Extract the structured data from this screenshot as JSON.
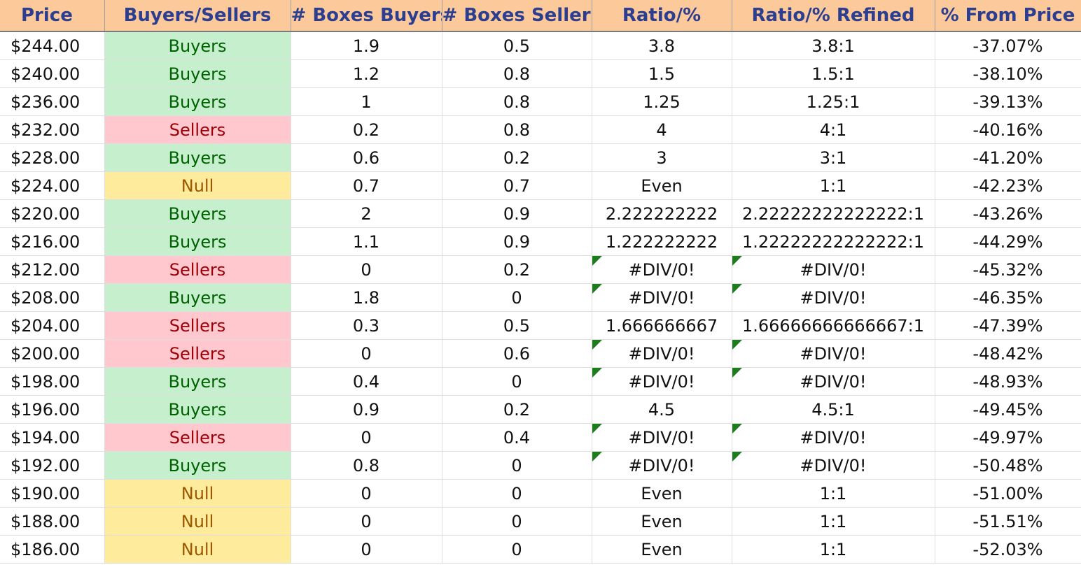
{
  "colors": {
    "header_bg": "#fcc99b",
    "header_text": "#2c3e8f",
    "buyers_bg": "#c6efce",
    "buyers_text": "#006100",
    "sellers_bg": "#ffc7ce",
    "sellers_text": "#9c0006",
    "null_bg": "#ffeb9c",
    "null_text": "#9c5700",
    "error_flag": "#1e7b1e"
  },
  "table": {
    "headers": [
      "Price",
      "Buyers/Sellers",
      "# Boxes Buyers",
      "# Boxes Sellers",
      "Ratio/%",
      "Ratio/% Refined",
      "% From Price"
    ],
    "rows": [
      {
        "price": "$244.00",
        "side": "Buyers",
        "boxes_buyers": "1.9",
        "boxes_sellers": "0.5",
        "ratio": "3.8",
        "ratio_refined": "3.8:1",
        "pct_from_price": "-37.07%",
        "error_flag": false
      },
      {
        "price": "$240.00",
        "side": "Buyers",
        "boxes_buyers": "1.2",
        "boxes_sellers": "0.8",
        "ratio": "1.5",
        "ratio_refined": "1.5:1",
        "pct_from_price": "-38.10%",
        "error_flag": false
      },
      {
        "price": "$236.00",
        "side": "Buyers",
        "boxes_buyers": "1",
        "boxes_sellers": "0.8",
        "ratio": "1.25",
        "ratio_refined": "1.25:1",
        "pct_from_price": "-39.13%",
        "error_flag": false
      },
      {
        "price": "$232.00",
        "side": "Sellers",
        "boxes_buyers": "0.2",
        "boxes_sellers": "0.8",
        "ratio": "4",
        "ratio_refined": "4:1",
        "pct_from_price": "-40.16%",
        "error_flag": false
      },
      {
        "price": "$228.00",
        "side": "Buyers",
        "boxes_buyers": "0.6",
        "boxes_sellers": "0.2",
        "ratio": "3",
        "ratio_refined": "3:1",
        "pct_from_price": "-41.20%",
        "error_flag": false
      },
      {
        "price": "$224.00",
        "side": "Null",
        "boxes_buyers": "0.7",
        "boxes_sellers": "0.7",
        "ratio": "Even",
        "ratio_refined": "1:1",
        "pct_from_price": "-42.23%",
        "error_flag": false
      },
      {
        "price": "$220.00",
        "side": "Buyers",
        "boxes_buyers": "2",
        "boxes_sellers": "0.9",
        "ratio": "2.222222222",
        "ratio_refined": "2.22222222222222:1",
        "pct_from_price": "-43.26%",
        "error_flag": false
      },
      {
        "price": "$216.00",
        "side": "Buyers",
        "boxes_buyers": "1.1",
        "boxes_sellers": "0.9",
        "ratio": "1.222222222",
        "ratio_refined": "1.22222222222222:1",
        "pct_from_price": "-44.29%",
        "error_flag": false
      },
      {
        "price": "$212.00",
        "side": "Sellers",
        "boxes_buyers": "0",
        "boxes_sellers": "0.2",
        "ratio": "#DIV/0!",
        "ratio_refined": "#DIV/0!",
        "pct_from_price": "-45.32%",
        "error_flag": true
      },
      {
        "price": "$208.00",
        "side": "Buyers",
        "boxes_buyers": "1.8",
        "boxes_sellers": "0",
        "ratio": "#DIV/0!",
        "ratio_refined": "#DIV/0!",
        "pct_from_price": "-46.35%",
        "error_flag": true
      },
      {
        "price": "$204.00",
        "side": "Sellers",
        "boxes_buyers": "0.3",
        "boxes_sellers": "0.5",
        "ratio": "1.666666667",
        "ratio_refined": "1.66666666666667:1",
        "pct_from_price": "-47.39%",
        "error_flag": false
      },
      {
        "price": "$200.00",
        "side": "Sellers",
        "boxes_buyers": "0",
        "boxes_sellers": "0.6",
        "ratio": "#DIV/0!",
        "ratio_refined": "#DIV/0!",
        "pct_from_price": "-48.42%",
        "error_flag": true
      },
      {
        "price": "$198.00",
        "side": "Buyers",
        "boxes_buyers": "0.4",
        "boxes_sellers": "0",
        "ratio": "#DIV/0!",
        "ratio_refined": "#DIV/0!",
        "pct_from_price": "-48.93%",
        "error_flag": true
      },
      {
        "price": "$196.00",
        "side": "Buyers",
        "boxes_buyers": "0.9",
        "boxes_sellers": "0.2",
        "ratio": "4.5",
        "ratio_refined": "4.5:1",
        "pct_from_price": "-49.45%",
        "error_flag": false
      },
      {
        "price": "$194.00",
        "side": "Sellers",
        "boxes_buyers": "0",
        "boxes_sellers": "0.4",
        "ratio": "#DIV/0!",
        "ratio_refined": "#DIV/0!",
        "pct_from_price": "-49.97%",
        "error_flag": true
      },
      {
        "price": "$192.00",
        "side": "Buyers",
        "boxes_buyers": "0.8",
        "boxes_sellers": "0",
        "ratio": "#DIV/0!",
        "ratio_refined": "#DIV/0!",
        "pct_from_price": "-50.48%",
        "error_flag": true
      },
      {
        "price": "$190.00",
        "side": "Null",
        "boxes_buyers": "0",
        "boxes_sellers": "0",
        "ratio": "Even",
        "ratio_refined": "1:1",
        "pct_from_price": "-51.00%",
        "error_flag": false
      },
      {
        "price": "$188.00",
        "side": "Null",
        "boxes_buyers": "0",
        "boxes_sellers": "0",
        "ratio": "Even",
        "ratio_refined": "1:1",
        "pct_from_price": "-51.51%",
        "error_flag": false
      },
      {
        "price": "$186.00",
        "side": "Null",
        "boxes_buyers": "0",
        "boxes_sellers": "0",
        "ratio": "Even",
        "ratio_refined": "1:1",
        "pct_from_price": "-52.03%",
        "error_flag": false
      }
    ]
  }
}
